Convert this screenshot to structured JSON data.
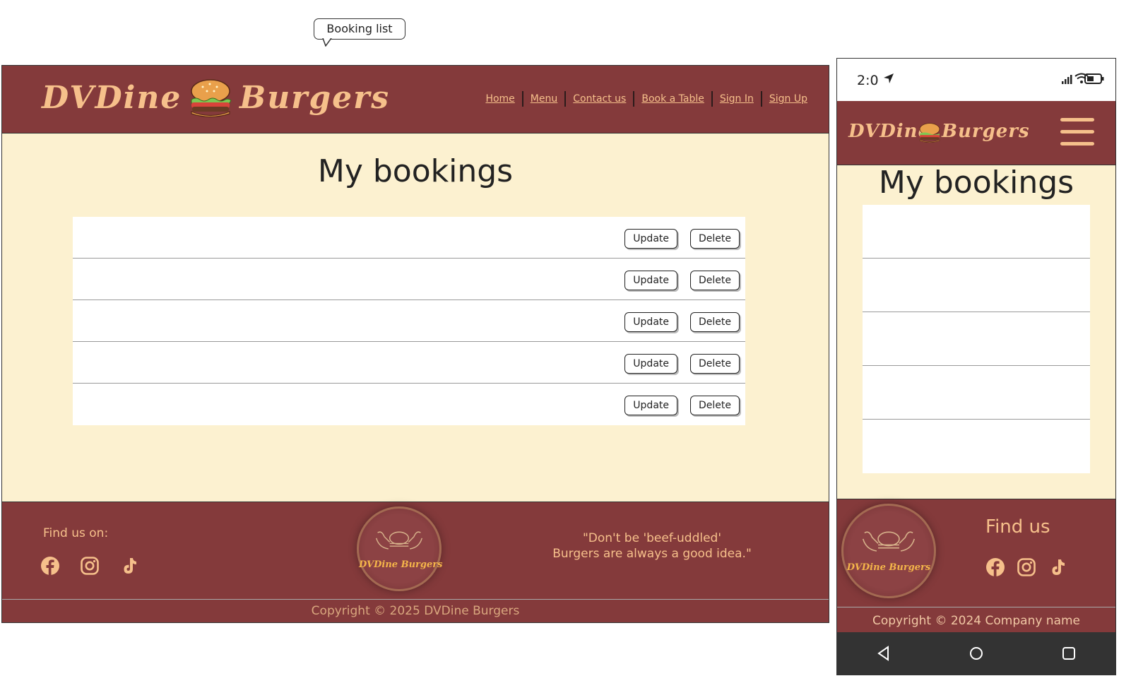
{
  "callout": {
    "label": "Booking list"
  },
  "desktop": {
    "brand": {
      "left": "DVDine",
      "right": "Burgers"
    },
    "nav": [
      "Home",
      "Menu",
      "Contact us",
      "Book a Table",
      "Sign In",
      "Sign Up"
    ],
    "page_title": "My bookings",
    "bookings": [
      {
        "update_label": "Update",
        "delete_label": "Delete"
      },
      {
        "update_label": "Update",
        "delete_label": "Delete"
      },
      {
        "update_label": "Update",
        "delete_label": "Delete"
      },
      {
        "update_label": "Update",
        "delete_label": "Delete"
      },
      {
        "update_label": "Update",
        "delete_label": "Delete"
      }
    ],
    "footer": {
      "find_us": "Find us on:",
      "logo_text": "DVDine Burgers",
      "quote_line1": "\"Don't be 'beef-uddled'",
      "quote_line2": "Burgers are always a good idea.\"",
      "copyright": "Copyright © 2025 DVDine Burgers"
    }
  },
  "mobile": {
    "status": {
      "time": "2:0"
    },
    "brand": {
      "left": "DVDine",
      "right": "Burgers"
    },
    "page_title": "My bookings",
    "footer": {
      "logo_text": "DVDine Burgers",
      "find_us": "Find us",
      "copyright": "Copyright © 2024 Company name"
    }
  },
  "social_icons": [
    "facebook-icon",
    "instagram-icon",
    "tiktok-icon"
  ],
  "colors": {
    "header_bg": "#843a3b",
    "body_bg": "#fcf1d0",
    "accent": "#f6c08b"
  }
}
